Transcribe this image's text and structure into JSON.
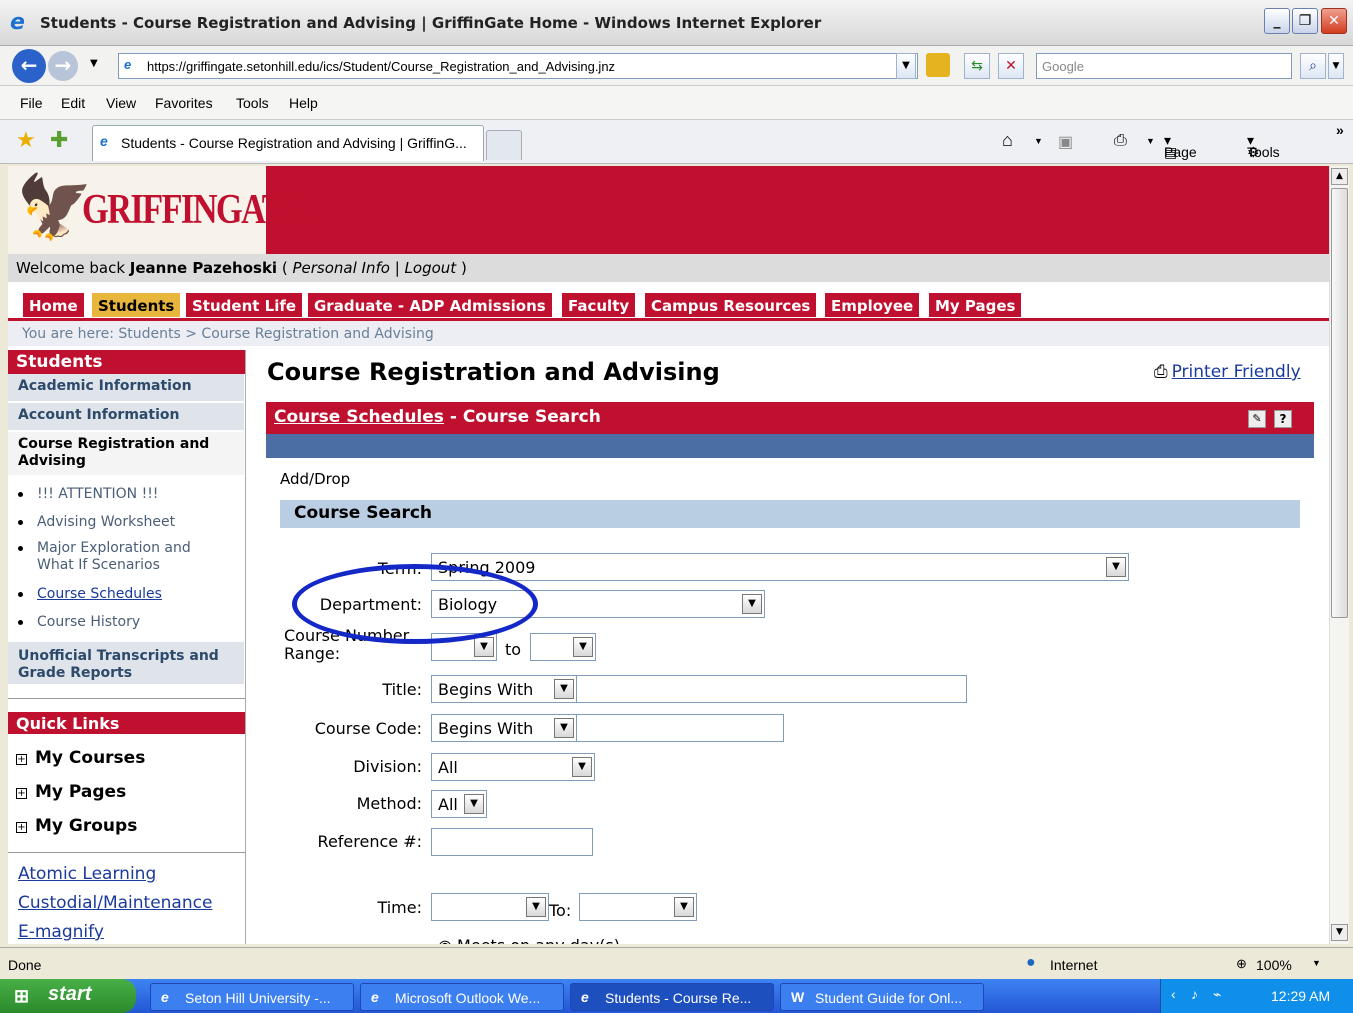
{
  "window": {
    "title": "Students - Course Registration and Advising | GriffinGate Home - Windows Internet Explorer"
  },
  "browser": {
    "url": "https://griffingate.setonhill.edu/ics/Student/Course_Registration_and_Advising.jnz",
    "search_placeholder": "Google",
    "menu": [
      "File",
      "Edit",
      "View",
      "Favorites",
      "Tools",
      "Help"
    ],
    "tab_title": "Students - Course Registration and Advising | GriffinG...",
    "toolbar": {
      "page_label": "Page",
      "tools_label": "Tools"
    }
  },
  "site": {
    "logo_text": "GRIFFINGATE",
    "welcome_prefix": "Welcome back ",
    "user_name": "Jeanne Pazehoski",
    "personal_info": "Personal Info",
    "logout": "Logout",
    "nav_tabs": [
      "Home",
      "Students",
      "Student Life",
      "Graduate - ADP Admissions",
      "Faculty",
      "Campus Resources",
      "Employee",
      "My Pages"
    ],
    "breadcrumb": "You are here:  Students > Course Registration and Advising"
  },
  "sidebar": {
    "heading": "Students",
    "academic_information": "Academic Information",
    "account_information": "Account Information",
    "course_registration": "Course Registration and Advising",
    "sub_items": [
      "!!! ATTENTION !!!",
      "Advising Worksheet",
      "Major Exploration and What If Scenarios",
      "Course Schedules",
      "Course History"
    ],
    "transcripts": "Unofficial Transcripts and Grade Reports",
    "quick_links_heading": "Quick Links",
    "quick_links": [
      "My Courses",
      "My Pages",
      "My Groups"
    ],
    "links": [
      "Atomic Learning",
      "Custodial/Maintenance",
      "E-magnify"
    ]
  },
  "main": {
    "page_title": "Course Registration and Advising",
    "printer_friendly": "Printer Friendly",
    "portlet_link": "Course Schedules",
    "portlet_title": " - Course Search",
    "add_drop": "Add/Drop",
    "section_title": "Course Search",
    "form": {
      "term_label": "Term:",
      "term_value": "Spring 2009",
      "department_label": "Department:",
      "department_value": "Biology",
      "course_number_label": "Course Number Range:",
      "to_label": "to",
      "title_label": "Title:",
      "title_mode": "Begins With",
      "course_code_label": "Course Code:",
      "course_code_mode": "Begins With",
      "division_label": "Division:",
      "division_value": "All",
      "method_label": "Method:",
      "method_value": "All",
      "reference_label": "Reference #:",
      "time_label": "Time:",
      "time_to_label": "To:",
      "meets_text": "Meets on any day(s)"
    }
  },
  "statusbar": {
    "text": "Done",
    "zone": "Internet",
    "zoom": "100%"
  },
  "taskbar": {
    "start": "start",
    "items": [
      "Seton Hill University -...",
      "Microsoft Outlook We...",
      "Students - Course Re...",
      "Student Guide for Onl..."
    ],
    "clock": "12:29 AM"
  }
}
